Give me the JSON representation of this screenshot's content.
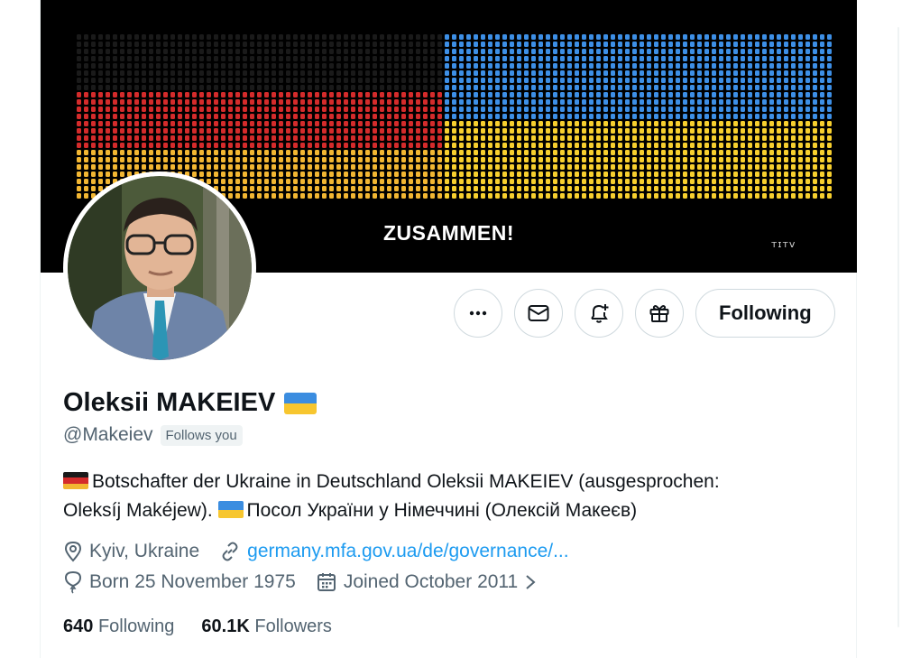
{
  "banner": {
    "caption": "ZUSAMMEN!",
    "mark": "ᴛɪᴛᴠ",
    "colors": {
      "black": "#1a1a1a",
      "red": "#d42b2b",
      "gold": "#f2b632",
      "blue": "#3d8fe6",
      "yellow": "#f7cf2e"
    }
  },
  "profile": {
    "name": "Oleksii MAKEIEV",
    "handle": "@Makeiev",
    "follows_you": "Follows you",
    "bio_line1": "Botschafter der Ukraine in Deutschland Oleksii MAKEIEV (ausgesprochen:",
    "bio_line2a": "Oleksíj Makéjew).",
    "bio_line2b": "Посол України у Німеччині (Олексій Макеєв)",
    "location": "Kyiv, Ukraine",
    "website": "germany.mfa.gov.ua/de/governance/...",
    "born": "Born 25 November 1975",
    "joined": "Joined October 2011",
    "following_count": "640",
    "following_label": "Following",
    "followers_count": "60.1K",
    "followers_label": "Followers"
  },
  "actions": {
    "more_icon": "ellipsis-icon",
    "message_icon": "envelope-icon",
    "notify_icon": "bell-plus-icon",
    "gift_icon": "gift-icon",
    "follow_label": "Following"
  },
  "icons": {
    "location": "location-pin-icon",
    "link": "link-icon",
    "birthday": "balloon-icon",
    "calendar": "calendar-icon",
    "chevron": "chevron-right-icon"
  },
  "colors": {
    "text": "#0f1419",
    "muted": "#536471",
    "link": "#1d9bf0",
    "border": "#cfd9de"
  }
}
